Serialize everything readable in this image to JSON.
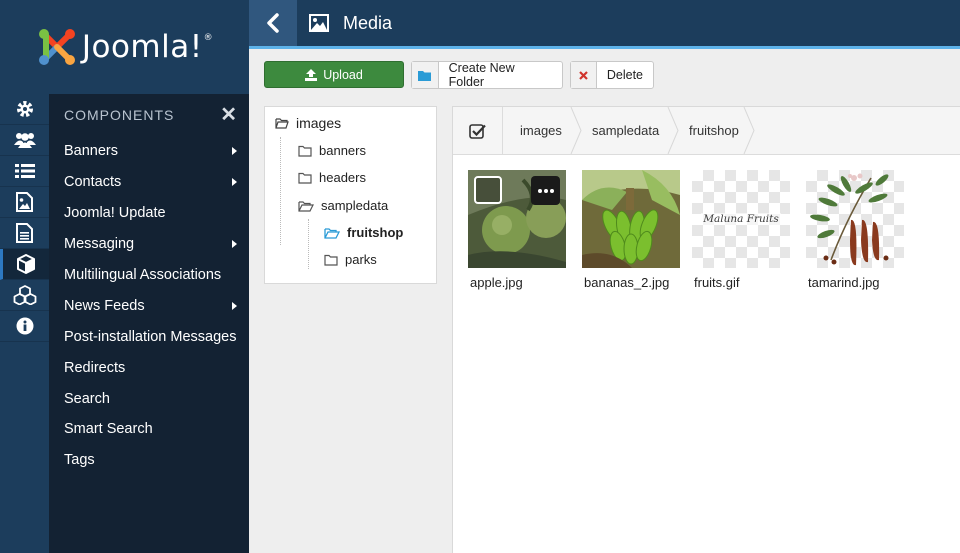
{
  "brand": {
    "name": "Joomla!"
  },
  "header": {
    "title": "Media",
    "title_icon": "image-icon",
    "back_icon": "chevron-left-icon"
  },
  "colors": {
    "header_bg": "#1c3d5c",
    "accent": "#5db2e9",
    "upload_green": "#3d8a3e",
    "flyout_bg": "#132233"
  },
  "rail": [
    {
      "icon": "gear-icon"
    },
    {
      "icon": "users-icon"
    },
    {
      "icon": "list-icon"
    },
    {
      "icon": "image-icon"
    },
    {
      "icon": "document-icon"
    },
    {
      "icon": "cube-icon",
      "active": true
    },
    {
      "icon": "cubes-icon"
    },
    {
      "icon": "info-icon"
    }
  ],
  "flyout": {
    "title": "COMPONENTS",
    "items": [
      {
        "label": "Banners",
        "has_submenu": true
      },
      {
        "label": "Contacts",
        "has_submenu": true
      },
      {
        "label": "Joomla! Update"
      },
      {
        "label": "Messaging",
        "has_submenu": true
      },
      {
        "label": "Multilingual Associations"
      },
      {
        "label": "News Feeds",
        "has_submenu": true
      },
      {
        "label": "Post-installation Messages"
      },
      {
        "label": "Redirects"
      },
      {
        "label": "Search"
      },
      {
        "label": "Smart Search"
      },
      {
        "label": "Tags"
      }
    ]
  },
  "toolbar": {
    "upload_label": "Upload",
    "new_folder_label": "Create New Folder",
    "delete_label": "Delete"
  },
  "tree": {
    "root": "images",
    "folders": [
      "banners",
      "headers",
      "sampledata"
    ],
    "sampledata_children": [
      "fruitshop",
      "parks"
    ],
    "selected": "fruitshop"
  },
  "breadcrumb": [
    "images",
    "sampledata",
    "fruitshop"
  ],
  "files": [
    {
      "name": "apple.jpg",
      "selected_hover": true
    },
    {
      "name": "bananas_2.jpg"
    },
    {
      "name": "fruits.gif",
      "image_text": "Maluna Fruits"
    },
    {
      "name": "tamarind.jpg"
    }
  ]
}
